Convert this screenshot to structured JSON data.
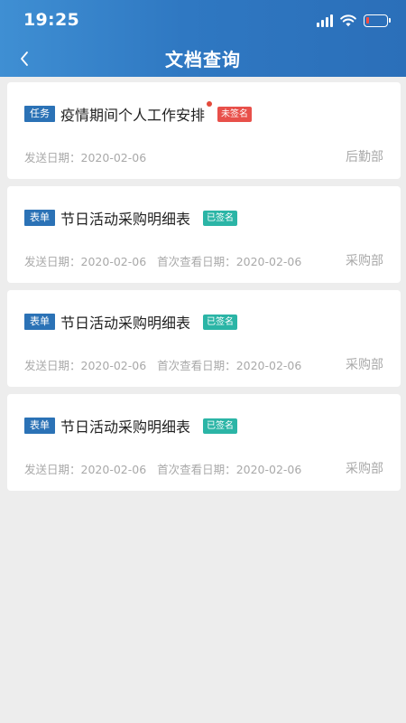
{
  "status_bar": {
    "time": "19:25",
    "battery_level": 0.15,
    "icons": [
      "signal-icon",
      "wifi-icon",
      "battery-icon"
    ]
  },
  "nav": {
    "title": "文档查询",
    "back_icon": "chevron-left-icon"
  },
  "colors": {
    "header": "#2f78c2",
    "type_tag": "#2b72b6",
    "unsigned": "#e8504a",
    "signed": "#2bb5a6",
    "red_dot": "#e34a3a"
  },
  "documents": [
    {
      "type": "任务",
      "title": "疫情期间个人工作安排",
      "unread": true,
      "status": "未签名",
      "status_kind": "unsigned",
      "send_label": "发送日期：",
      "send_date": "2020-02-06",
      "view_label": "",
      "view_date": "",
      "department": "后勤部"
    },
    {
      "type": "表单",
      "title": "节日活动采购明细表",
      "unread": false,
      "status": "已签名",
      "status_kind": "signed",
      "send_label": "发送日期：",
      "send_date": "2020-02-06",
      "view_label": "首次查看日期：",
      "view_date": "2020-02-06",
      "department": "采购部"
    },
    {
      "type": "表单",
      "title": "节日活动采购明细表",
      "unread": false,
      "status": "已签名",
      "status_kind": "signed",
      "send_label": "发送日期：",
      "send_date": "2020-02-06",
      "view_label": "首次查看日期：",
      "view_date": "2020-02-06",
      "department": "采购部"
    },
    {
      "type": "表单",
      "title": "节日活动采购明细表",
      "unread": false,
      "status": "已签名",
      "status_kind": "signed",
      "send_label": "发送日期：",
      "send_date": "2020-02-06",
      "view_label": "首次查看日期：",
      "view_date": "2020-02-06",
      "department": "采购部"
    }
  ]
}
